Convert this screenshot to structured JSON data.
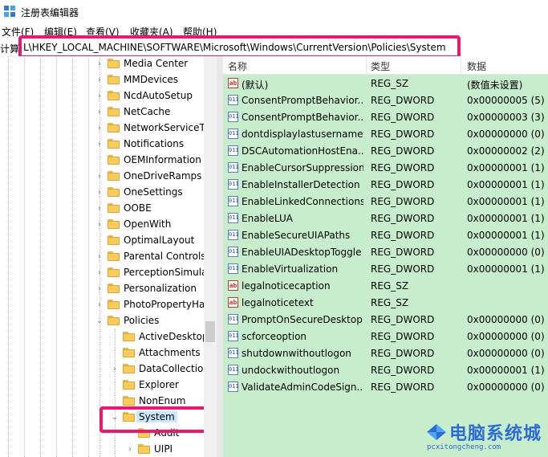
{
  "window": {
    "title": "注册表编辑器"
  },
  "menu": [
    "文件(F)",
    "编辑(E)",
    "查看(V)",
    "收藏夹(A)",
    "帮助(H)"
  ],
  "address": {
    "label": "计算",
    "path": "L\\HKEY_LOCAL_MACHINE\\SOFTWARE\\Microsoft\\Windows\\CurrentVersion\\Policies\\System"
  },
  "tree": [
    {
      "label": "Media Center",
      "expander": "collapsed",
      "selected": false
    },
    {
      "label": "MMDevices",
      "expander": "collapsed",
      "selected": false
    },
    {
      "label": "NcdAutoSetup",
      "expander": "collapsed",
      "selected": false
    },
    {
      "label": "NetCache",
      "expander": "collapsed",
      "selected": false
    },
    {
      "label": "NetworkServiceT",
      "expander": "collapsed",
      "selected": false
    },
    {
      "label": "Notifications",
      "expander": "collapsed",
      "selected": false
    },
    {
      "label": "OEMInformation",
      "expander": "none",
      "selected": false
    },
    {
      "label": "OneDriveRamps",
      "expander": "collapsed",
      "selected": false
    },
    {
      "label": "OneSettings",
      "expander": "collapsed",
      "selected": false
    },
    {
      "label": "OOBE",
      "expander": "collapsed",
      "selected": false
    },
    {
      "label": "OpenWith",
      "expander": "collapsed",
      "selected": false
    },
    {
      "label": "OptimalLayout",
      "expander": "none",
      "selected": false
    },
    {
      "label": "Parental Controls",
      "expander": "collapsed",
      "selected": false
    },
    {
      "label": "PerceptionSimula",
      "expander": "collapsed",
      "selected": false
    },
    {
      "label": "Personalization",
      "expander": "collapsed",
      "selected": false
    },
    {
      "label": "PhotoPropertyHa",
      "expander": "collapsed",
      "selected": false
    },
    {
      "label": "Policies",
      "expander": "expanded",
      "selected": false
    },
    {
      "label": "ActiveDesktop",
      "expander": "none",
      "selected": false
    },
    {
      "label": "Attachments",
      "expander": "none",
      "selected": false
    },
    {
      "label": "DataCollection",
      "expander": "collapsed",
      "selected": false
    },
    {
      "label": "Explorer",
      "expander": "none",
      "selected": false
    },
    {
      "label": "NonEnum",
      "expander": "none",
      "selected": false
    },
    {
      "label": "System",
      "expander": "expanded",
      "selected": true
    },
    {
      "label": "Audit",
      "expander": "none",
      "selected": false
    },
    {
      "label": "UIPI",
      "expander": "collapsed",
      "selected": false
    }
  ],
  "columns": {
    "name": "名称",
    "type": "类型",
    "data": "数据"
  },
  "values": [
    {
      "icon": "string-value-icon",
      "name": "(默认)",
      "type": "REG_SZ",
      "data": "(数值未设置)"
    },
    {
      "icon": "dword-value-icon",
      "name": "ConsentPromptBehavior...",
      "type": "REG_DWORD",
      "data": "0x00000005 (5)"
    },
    {
      "icon": "dword-value-icon",
      "name": "ConsentPromptBehavior...",
      "type": "REG_DWORD",
      "data": "0x00000003 (3)"
    },
    {
      "icon": "dword-value-icon",
      "name": "dontdisplaylastusername",
      "type": "REG_DWORD",
      "data": "0x00000000 (0)"
    },
    {
      "icon": "dword-value-icon",
      "name": "DSCAutomationHostEna...",
      "type": "REG_DWORD",
      "data": "0x00000002 (2)"
    },
    {
      "icon": "dword-value-icon",
      "name": "EnableCursorSuppression",
      "type": "REG_DWORD",
      "data": "0x00000001 (1)"
    },
    {
      "icon": "dword-value-icon",
      "name": "EnableInstallerDetection",
      "type": "REG_DWORD",
      "data": "0x00000001 (1)"
    },
    {
      "icon": "dword-value-icon",
      "name": "EnableLinkedConnections",
      "type": "REG_DWORD",
      "data": "0x00000001 (1)"
    },
    {
      "icon": "dword-value-icon",
      "name": "EnableLUA",
      "type": "REG_DWORD",
      "data": "0x00000001 (1)"
    },
    {
      "icon": "dword-value-icon",
      "name": "EnableSecureUIAPaths",
      "type": "REG_DWORD",
      "data": "0x00000001 (1)"
    },
    {
      "icon": "dword-value-icon",
      "name": "EnableUIADesktopToggle",
      "type": "REG_DWORD",
      "data": "0x00000000 (0)"
    },
    {
      "icon": "dword-value-icon",
      "name": "EnableVirtualization",
      "type": "REG_DWORD",
      "data": "0x00000001 (1)"
    },
    {
      "icon": "string-value-icon",
      "name": "legalnoticecaption",
      "type": "REG_SZ",
      "data": ""
    },
    {
      "icon": "string-value-icon",
      "name": "legalnoticetext",
      "type": "REG_SZ",
      "data": ""
    },
    {
      "icon": "dword-value-icon",
      "name": "PromptOnSecureDesktop",
      "type": "REG_DWORD",
      "data": "0x00000000 (0)"
    },
    {
      "icon": "dword-value-icon",
      "name": "scforceoption",
      "type": "REG_DWORD",
      "data": "0x00000000 (0)"
    },
    {
      "icon": "dword-value-icon",
      "name": "shutdownwithoutlogon",
      "type": "REG_DWORD",
      "data": "0x00000000 (0)"
    },
    {
      "icon": "dword-value-icon",
      "name": "undockwithoutlogon",
      "type": "REG_DWORD",
      "data": "0x00000001 (1)"
    },
    {
      "icon": "dword-value-icon",
      "name": "ValidateAdminCodeSign...",
      "type": "REG_DWORD",
      "data": "0x00000000 (0)"
    }
  ],
  "watermark": {
    "text": "电脑系统城",
    "url": "pcxitongcheng.com"
  },
  "colors": {
    "values_bg": "#c7edcc",
    "highlight_box": "#e8196e",
    "selection": "#cce8ff",
    "folder": "#f7cc5a"
  }
}
